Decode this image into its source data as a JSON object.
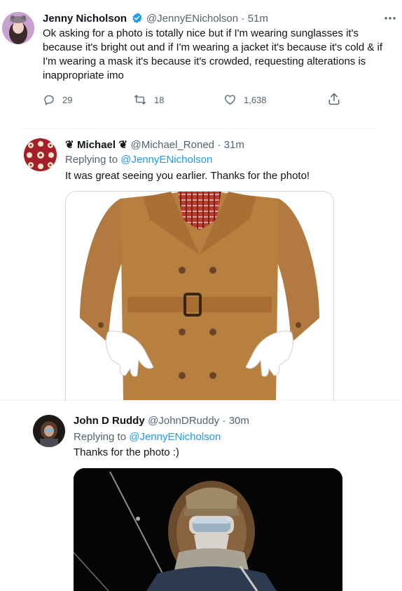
{
  "main_tweet": {
    "author_name": "Jenny Nicholson",
    "handle": "@JennyENicholson",
    "time": "· 51m",
    "text_lines": [
      "Ok asking for a photo is totally nice but if I'm wearing sunglasses it's",
      "because it's bright out and if I'm wearing a jacket it's because it's cold & if",
      "I'm wearing a mask it's because it's crowded, requesting alterations is",
      "inappropriate imo"
    ],
    "replies": "29",
    "retweets": "18",
    "likes": "1,638",
    "more_icon": "more-dots-icon"
  },
  "reply_1": {
    "author_name": "Michael",
    "name_emoji": "❦",
    "handle": "@Michael_Roned",
    "time": "· 31m",
    "replying_label": "Replying to",
    "replying_handle": "@JennyENicholson",
    "text": "It was great seeing you earlier. Thanks for the photo!"
  },
  "reply_2": {
    "author_name": "John D Ruddy",
    "handle": "@JohnDRuddy",
    "time": "· 30m",
    "replying_label": "Replying to",
    "replying_handle": "@JennyENicholson",
    "text": "Thanks for the photo :)"
  },
  "colors": {
    "accent": "#1d9bf0",
    "verified": "#1d9bf0",
    "muted": "#536471",
    "coat": "#b0793e"
  }
}
